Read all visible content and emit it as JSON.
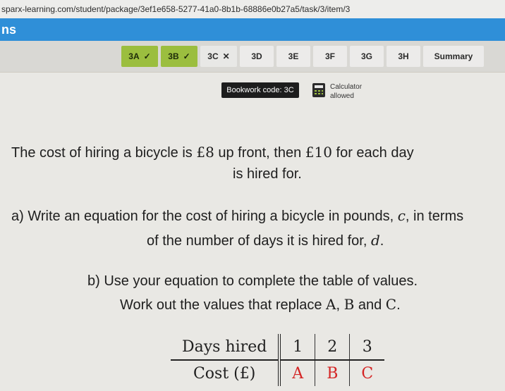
{
  "browser": {
    "url": "sparx-learning.com/student/package/3ef1e658-5277-41a0-8b1b-68886e0b27a5/task/3/item/3"
  },
  "app": {
    "title": "ns"
  },
  "tabs": [
    {
      "label": "3A",
      "status": "correct",
      "mark": "✓"
    },
    {
      "label": "3B",
      "status": "correct",
      "mark": "✓"
    },
    {
      "label": "3C",
      "status": "incorrect",
      "mark": "✕"
    },
    {
      "label": "3D",
      "status": "none",
      "mark": ""
    },
    {
      "label": "3E",
      "status": "none",
      "mark": ""
    },
    {
      "label": "3F",
      "status": "none",
      "mark": ""
    },
    {
      "label": "3G",
      "status": "none",
      "mark": ""
    },
    {
      "label": "3H",
      "status": "none",
      "mark": ""
    },
    {
      "label": "Summary",
      "status": "none",
      "mark": ""
    }
  ],
  "bookwork": {
    "label": "Bookwork code: 3C"
  },
  "calculator": {
    "line1": "Calculator",
    "line2": "allowed",
    "icon": "calculator-icon"
  },
  "question": {
    "intro_part1": "The cost of hiring a bicycle is ",
    "intro_money1": "£8",
    "intro_part2": " up front, then ",
    "intro_money2": "£10",
    "intro_part3": " for each day",
    "intro_line2": "is hired for.",
    "a_part1": "a) Write an equation for the cost of hiring a bicycle in pounds, ",
    "a_var_c": "c",
    "a_part2": ", in terms",
    "a_line2_part1": "of the number of days it is hired for, ",
    "a_var_d": "d",
    "a_line2_part2": ".",
    "b_line1": "b) Use your equation to complete the table of values.",
    "b_line2_part1": "Work out the values that replace ",
    "b_A": "A",
    "b_comma": ", ",
    "b_B": "B",
    "b_and": " and ",
    "b_C": "C",
    "b_end": "."
  },
  "table": {
    "row1": [
      "Days hired",
      "1",
      "2",
      "3"
    ],
    "row2": [
      "Cost (£)",
      "A",
      "B",
      "C"
    ]
  },
  "colors": {
    "appbar": "#2f8fd8",
    "correct_tab": "#9bbe3f",
    "table_unknowns": "#d42424"
  }
}
